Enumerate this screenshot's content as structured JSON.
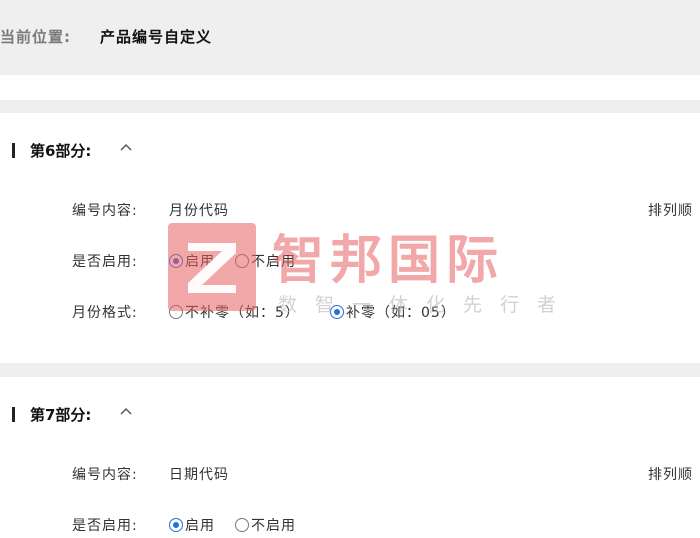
{
  "breadcrumb": {
    "label": "当前位置:",
    "current": "产品编号自定义"
  },
  "sections": [
    {
      "title": "第6部分:",
      "content_label": "编号内容:",
      "content_value": "月份代码",
      "order_label": "排列顺",
      "enable_label": "是否启用:",
      "enable_on": "启用",
      "enable_off": "不启用",
      "format_label": "月份格式:",
      "format_nopad": "不补零（如：5）",
      "format_pad": "补零（如：05）"
    },
    {
      "title": "第7部分:",
      "content_label": "编号内容:",
      "content_value": "日期代码",
      "order_label": "排列顺",
      "enable_label": "是否启用:",
      "enable_on": "启用",
      "enable_off": "不启用"
    }
  ],
  "watermark": {
    "brand": "智邦国际",
    "slogan": "数智一体化先行者"
  },
  "colors": {
    "accent": "#2a6dd6",
    "watermark": "#e85f62",
    "header_bg": "#efefef"
  }
}
